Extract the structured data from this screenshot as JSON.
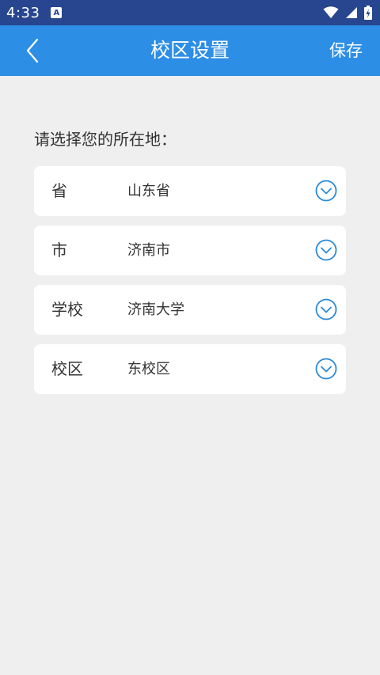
{
  "status_bar": {
    "time": "4:33",
    "notification_icon": "A"
  },
  "app_bar": {
    "title": "校区设置",
    "save_label": "保存"
  },
  "prompt": "请选择您的所在地：",
  "fields": [
    {
      "label": "省",
      "value": "山东省"
    },
    {
      "label": "市",
      "value": "济南市"
    },
    {
      "label": "学校",
      "value": "济南大学"
    },
    {
      "label": "校区",
      "value": "东校区"
    }
  ],
  "colors": {
    "status_bar": "#27468f",
    "app_bar": "#2d8ee6",
    "accent_icon": "#2a8ad6",
    "background": "#efefef"
  }
}
